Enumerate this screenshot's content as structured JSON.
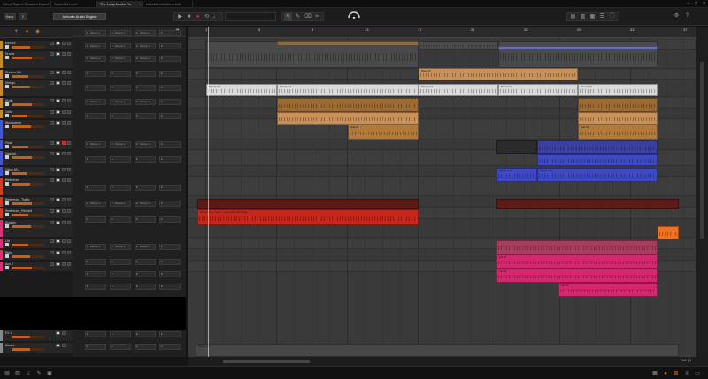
{
  "tabs": [
    {
      "label": "Steve Ryan's Omnium Expert",
      "active": false
    },
    {
      "label": "Sound of Love*",
      "active": false
    },
    {
      "label": "The Loop Looks Fin",
      "active": true
    },
    {
      "label": "mumble-brickbrub.bwt",
      "active": false
    }
  ],
  "toolbar": {
    "save_label": "Save",
    "audio_engine_label": "Activate Audio Engine"
  },
  "ruler": {
    "marks": [
      "1",
      "5",
      "9",
      "13",
      "17",
      "21",
      "25",
      "29",
      "33",
      "37"
    ]
  },
  "scene_label": "Scene 1",
  "colors": {
    "accent": "#f2701e",
    "tan": "#c8915a",
    "brown": "#9c6a33",
    "blue": "#3e49c5",
    "red": "#c8261d",
    "pink": "#d6266e",
    "mauve": "#a93d5e",
    "white_clip": "#d9d9d9",
    "stripe_white": "#e5e5e5",
    "stripe_yellow": "#c48a26",
    "stripe_blue": "#4457d0",
    "stripe_red": "#d03a28",
    "stripe_pink": "#d83275"
  },
  "tracks": [
    {
      "name": "Record",
      "stripe": "#c48a26"
    },
    {
      "name": "Drums",
      "stripe": "#c48a26"
    },
    {
      "name": "Rhodes Bel",
      "stripe": "#c48a26"
    },
    {
      "name": "Strings",
      "stripe": "#c48a26"
    },
    {
      "name": "Violin",
      "stripe": "#c48a26"
    },
    {
      "name": "Cello",
      "stripe": "#c48a26"
    },
    {
      "name": "Woodwinds",
      "stripe": "#4457d0"
    },
    {
      "name": "Flute",
      "stripe": "#4457d0"
    },
    {
      "name": "Clarinet",
      "stripe": "#4457d0"
    },
    {
      "name": "Oboe Alt 1",
      "stripe": "#4457d0"
    },
    {
      "name": "Reference",
      "stripe": "#d03a28"
    },
    {
      "name": "Reference_Traffic",
      "stripe": "#d03a28"
    },
    {
      "name": "Reference_Rebuild",
      "stripe": "#d03a28"
    },
    {
      "name": "Sustain",
      "stripe": "#d83275"
    },
    {
      "name": "Lift",
      "stripe": "#d83275"
    },
    {
      "name": "Right",
      "stripe": "#d83275"
    },
    {
      "name": "Aux 2",
      "stripe": "#d83275"
    }
  ],
  "fx_tracks": [
    {
      "name": "FX 1"
    },
    {
      "name": "Master"
    }
  ],
  "clips": {
    "bass_label": "Bass 01",
    "drums_label": "Drums 01",
    "strings_label": "Sad 01",
    "blue_label": "Rhodes 01",
    "ref_label": "Reference_Traffic - Loose Mix Vol.5.wav",
    "pink_label": "Lift 01",
    "bottom_label": "Master 01"
  },
  "bottom": {
    "zoom_readout": "1/8 | 1"
  }
}
